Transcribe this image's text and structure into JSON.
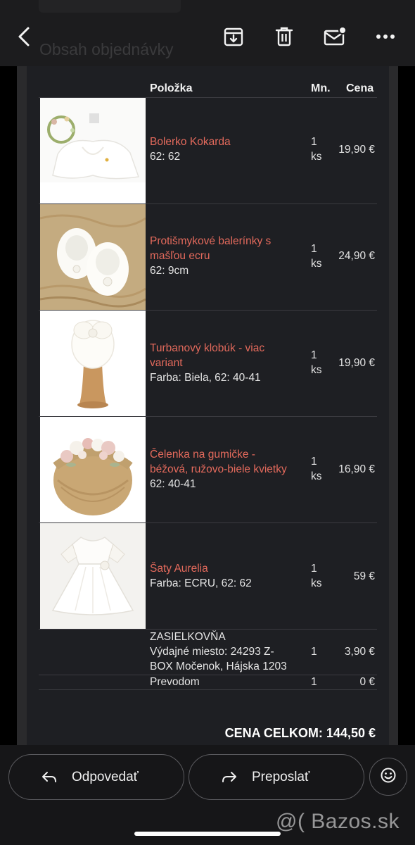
{
  "header": {
    "faded_title": "Obsah objednávky",
    "icons": [
      "back-arrow-icon",
      "archive-icon",
      "trash-icon",
      "mark-unread-icon",
      "more-options-icon"
    ]
  },
  "table": {
    "col_item": "Položka",
    "col_qty": "Mn.",
    "col_price": "Cena",
    "items": [
      {
        "name_line1": "Bolerko Kokarda",
        "name_line2": "",
        "variant": "62: 62",
        "qty_num": "1",
        "qty_unit": "ks",
        "price": "19,90 €"
      },
      {
        "name_line1": "Protišmykové balerínky s",
        "name_line2": "mašľou ecru",
        "variant": "62: 9cm",
        "qty_num": "1",
        "qty_unit": "ks",
        "price": "24,90 €"
      },
      {
        "name_line1": "Turbanový klobúk - viac",
        "name_line2": "variant",
        "variant": "Farba: Biela, 62: 40-41",
        "qty_num": "1",
        "qty_unit": "ks",
        "price": "19,90 €"
      },
      {
        "name_line1": "Čelenka na gumičke -",
        "name_line2": "béžová, ružovo-biele kvietky",
        "variant": "62: 40-41",
        "qty_num": "1",
        "qty_unit": "ks",
        "price": "16,90 €"
      },
      {
        "name_line1": "Šaty Aurelia",
        "name_line2": "",
        "variant": "Farba: ECRU, 62: 62",
        "qty_num": "1",
        "qty_unit": "ks",
        "price": "59 €"
      }
    ],
    "shipping": {
      "line1": "ZASIELKOVŇA",
      "line2": "Výdajné miesto: 24293 Z-",
      "line3": "BOX Močenok, Hájska 1203",
      "qty": "1",
      "price": "3,90 €"
    },
    "payment": {
      "label": "Prevodom",
      "qty": "1",
      "price": "0 €"
    },
    "total": "CENA CELKOM: 144,50 €"
  },
  "actions": {
    "reply_label": "Odpovedať",
    "forward_label": "Preposlať"
  },
  "watermark": "@( Bazos.sk",
  "colors": {
    "accent_link": "#e46a5c",
    "background": "#1e1f23"
  }
}
